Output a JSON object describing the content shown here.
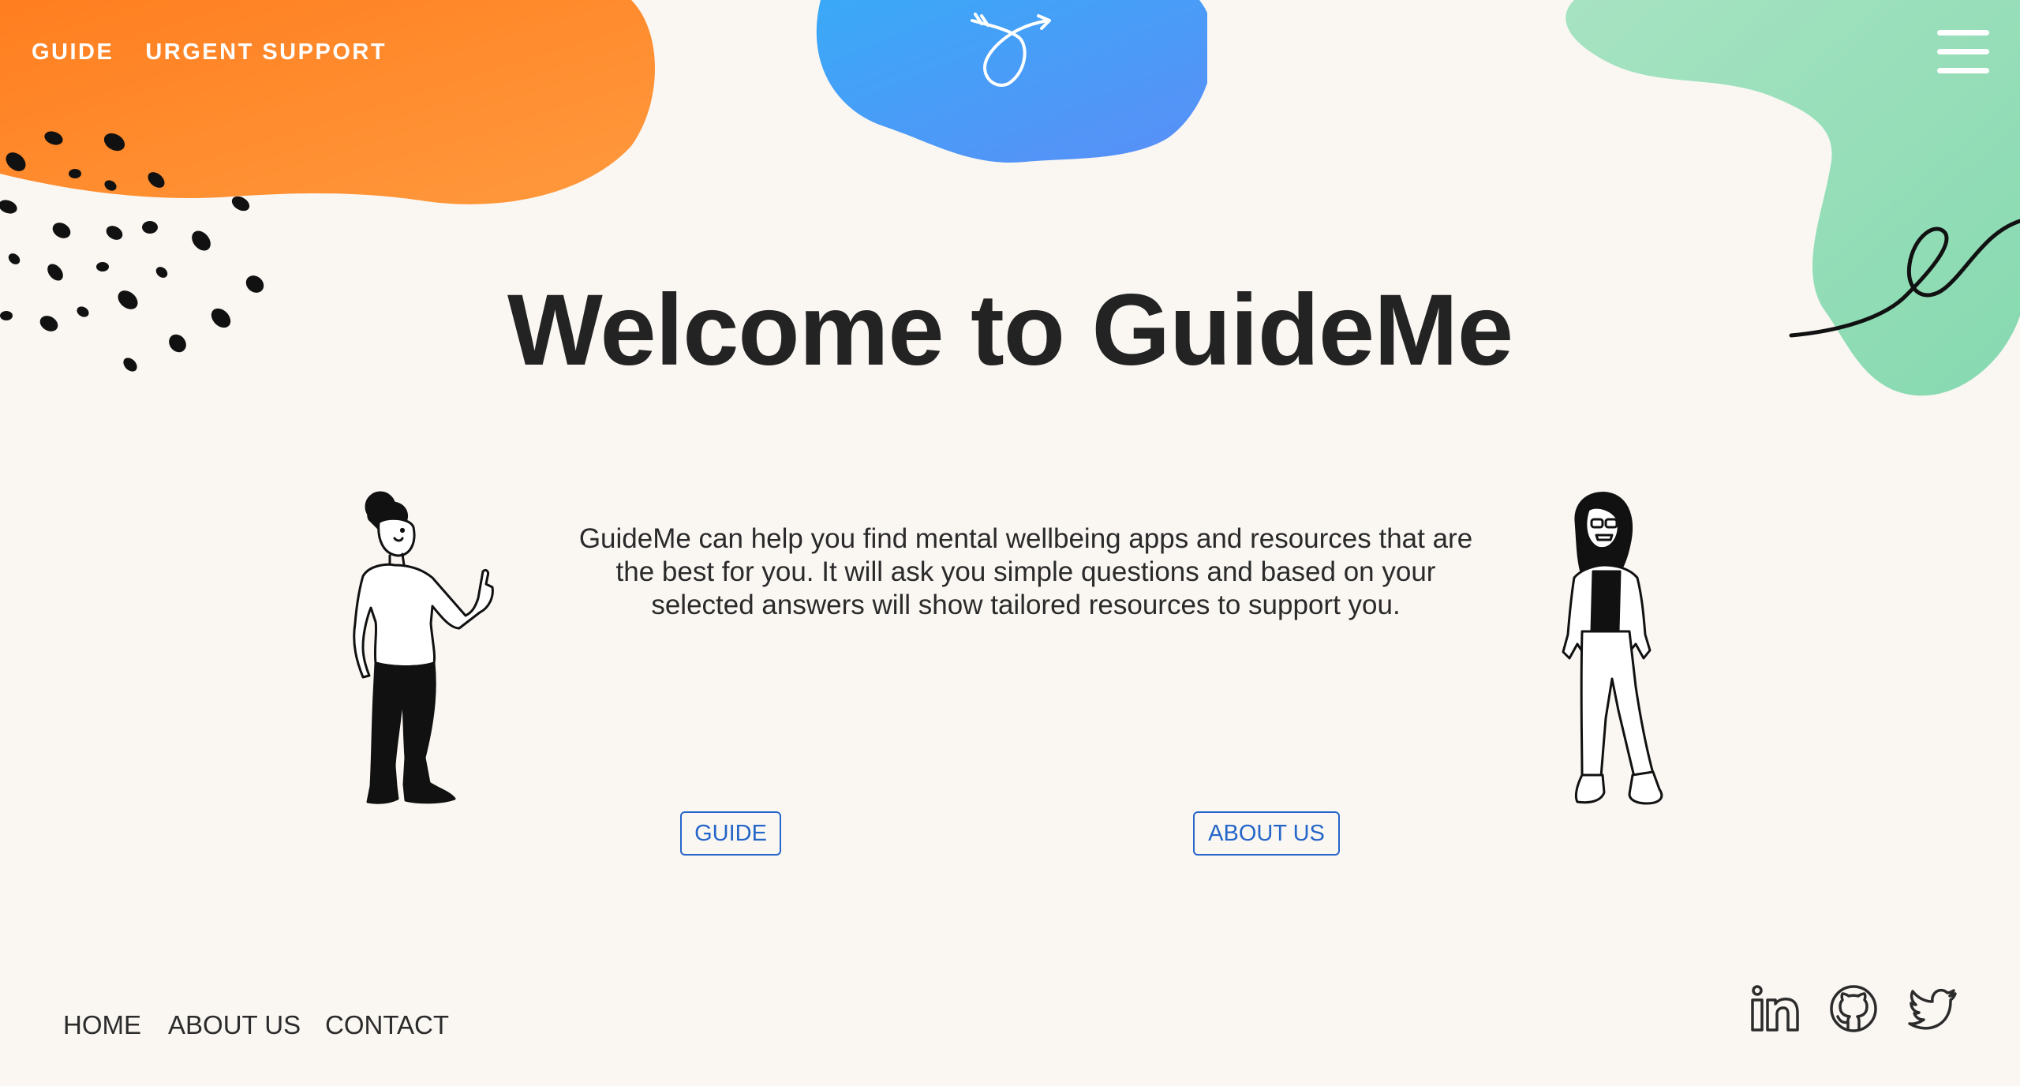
{
  "header": {
    "nav": [
      {
        "label": "GUIDE"
      },
      {
        "label": "URGENT SUPPORT"
      }
    ],
    "logo_icon": "looped-arrow-icon",
    "menu_icon": "hamburger-menu-icon"
  },
  "hero": {
    "title": "Welcome to GuideMe",
    "description": "GuideMe can help you find mental wellbeing apps and resources that are the best for you. It will ask you simple questions and based on your selected answers will show tailored resources to support you."
  },
  "buttons": {
    "guide": "GUIDE",
    "about": "ABOUT US"
  },
  "footer": {
    "links": [
      {
        "label": "HOME"
      },
      {
        "label": "ABOUT US"
      },
      {
        "label": "CONTACT"
      }
    ],
    "social_icons": [
      "linkedin-icon",
      "github-icon",
      "twitter-icon"
    ]
  },
  "colors": {
    "orange": "#ff8a2b",
    "blue": "#4a97f5",
    "green": "#8edcb4",
    "background": "#faf7f3",
    "button_blue": "#2566c9"
  }
}
